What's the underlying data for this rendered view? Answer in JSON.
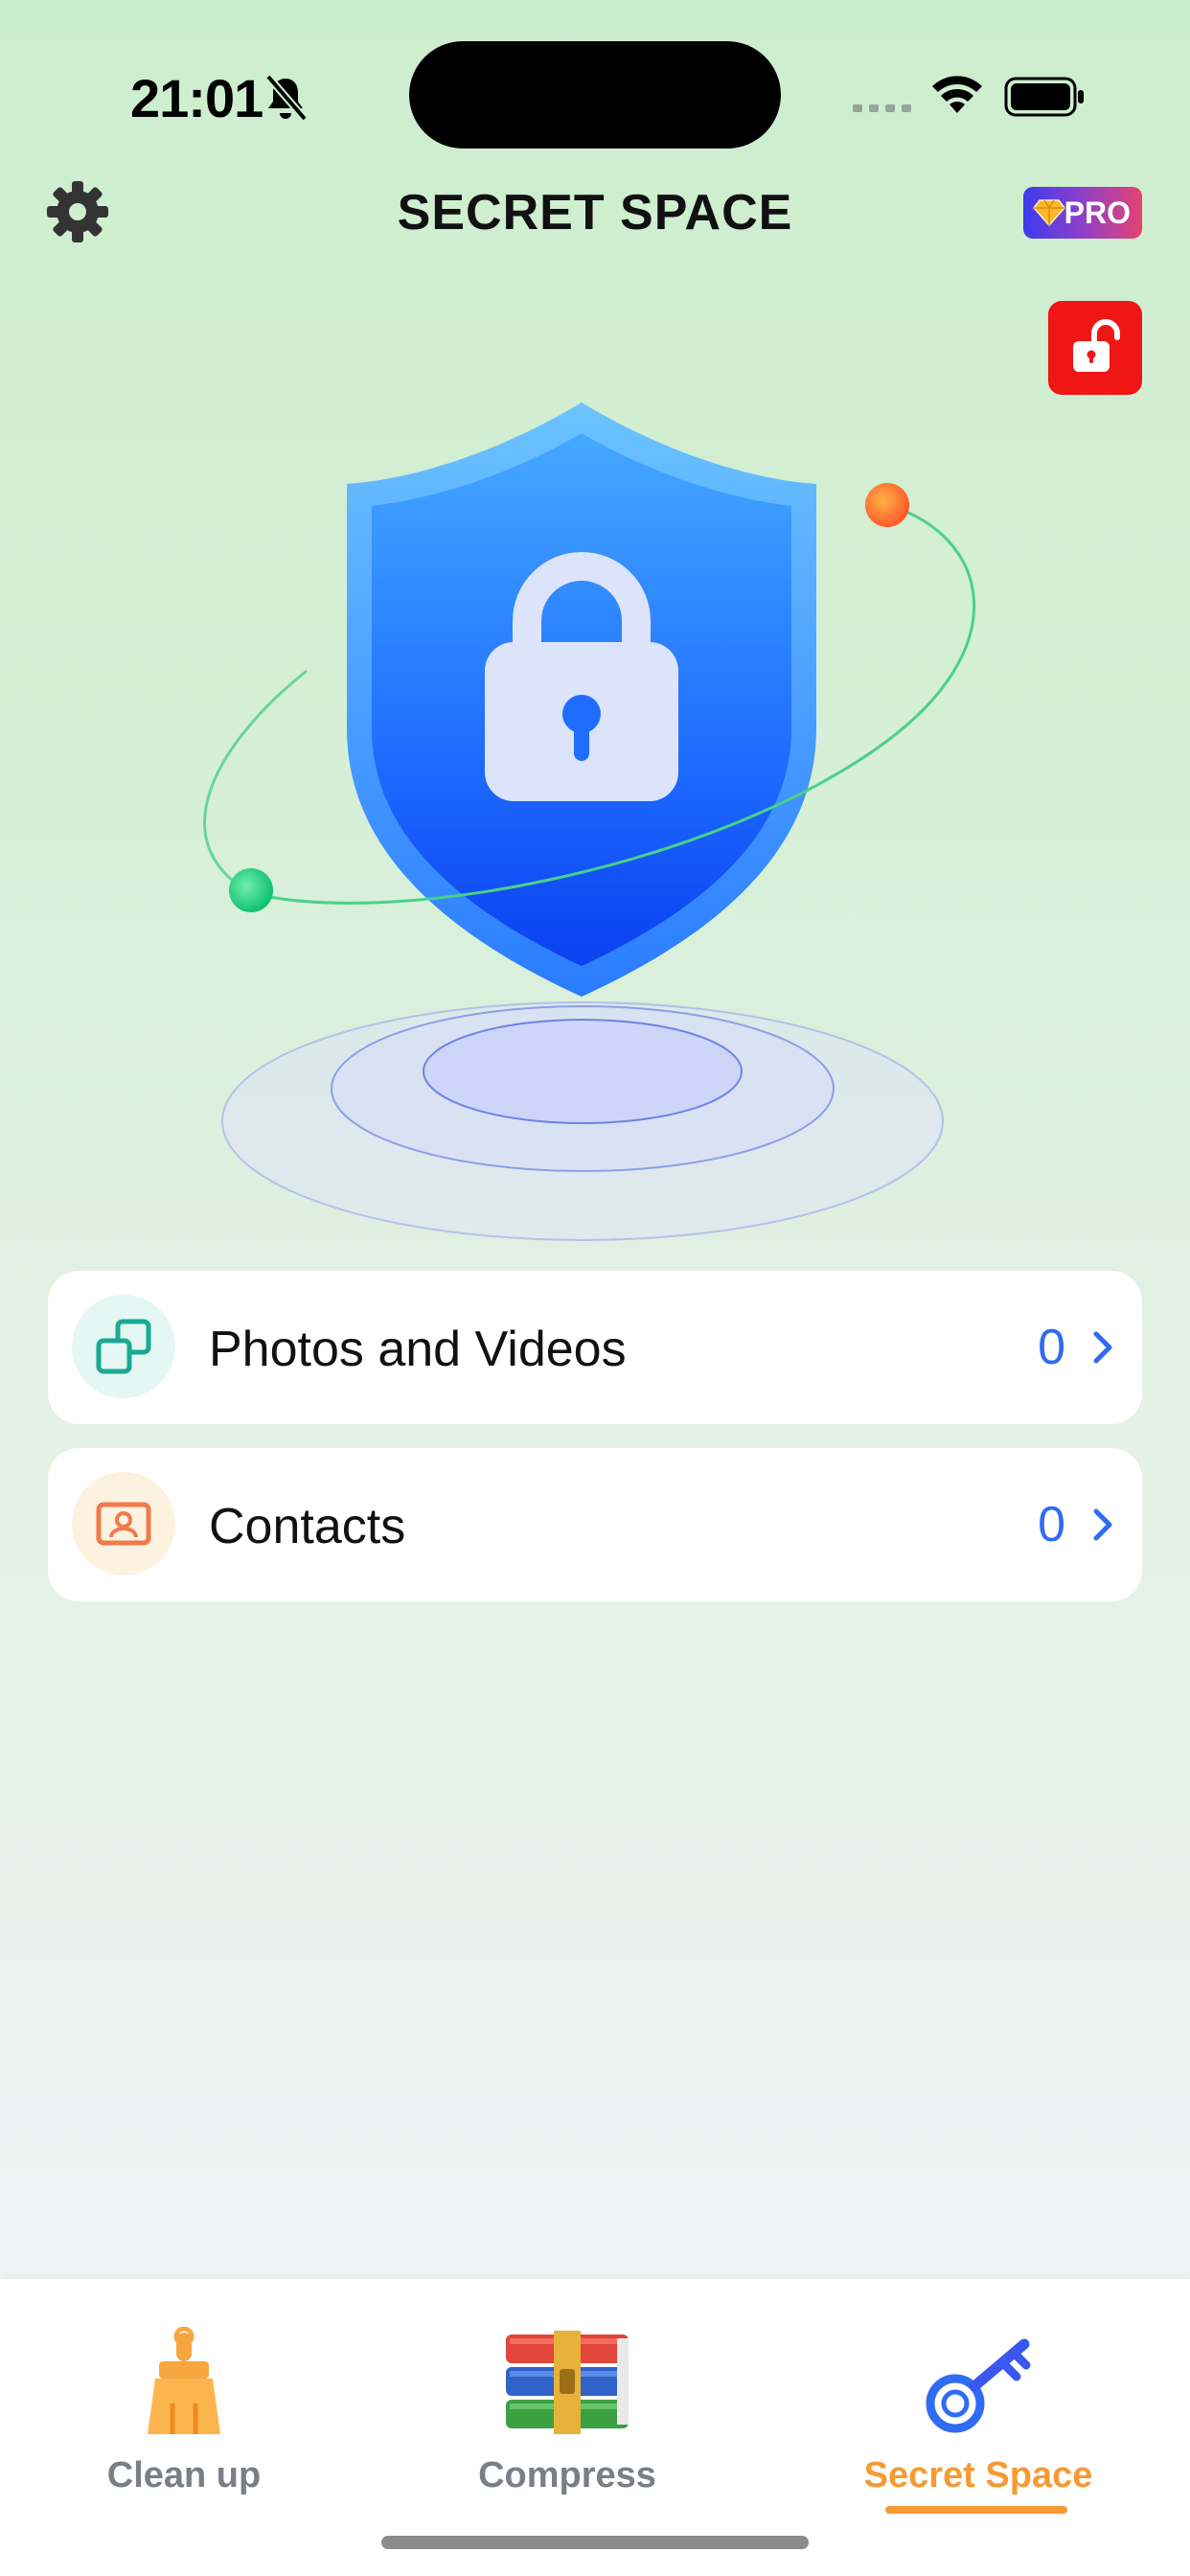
{
  "status_bar": {
    "time": "21:01"
  },
  "header": {
    "title": "SECRET SPACE",
    "pro_label": "PRO"
  },
  "list": [
    {
      "label": "Photos and Videos",
      "count": "0"
    },
    {
      "label": "Contacts",
      "count": "0"
    }
  ],
  "tabs": [
    {
      "label": "Clean up",
      "active": false
    },
    {
      "label": "Compress",
      "active": false
    },
    {
      "label": "Secret Space",
      "active": true
    }
  ],
  "colors": {
    "accent_orange": "#f59a34",
    "count_blue": "#2f6bf3",
    "unlock_red": "#f01616",
    "shield_blue": "#1e63ff"
  },
  "icons": {
    "settings": "gear-icon",
    "unlock": "unlock-icon",
    "photos": "photos-icon",
    "contacts": "contact-card-icon",
    "chevron": "chevron-right-icon"
  }
}
